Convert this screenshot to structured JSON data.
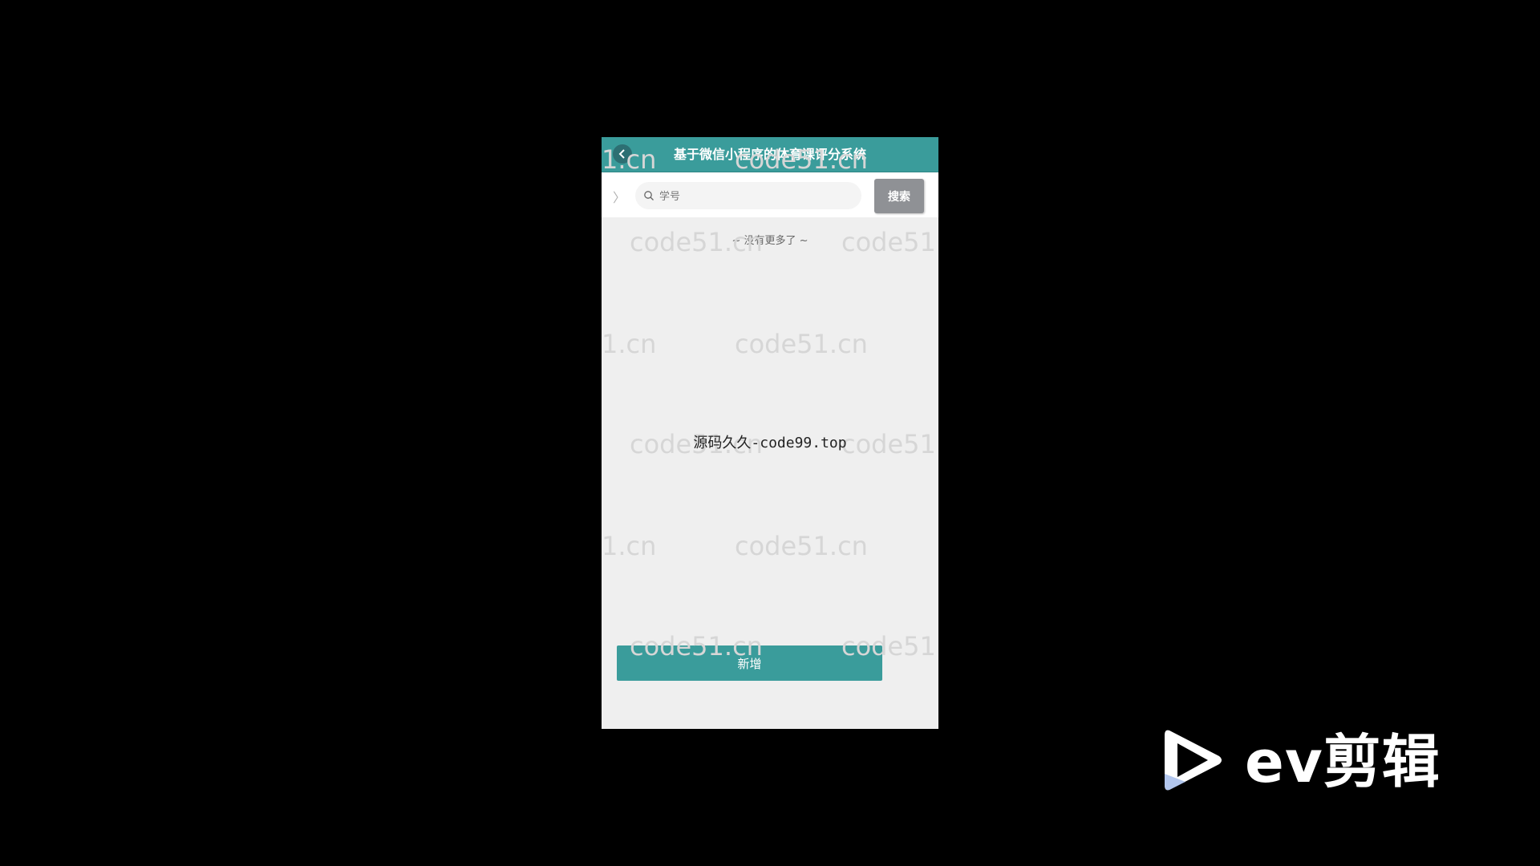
{
  "header": {
    "title": "基于微信小程序的体育课评分系统"
  },
  "search": {
    "placeholder": "学号",
    "button_label": "搜索"
  },
  "list": {
    "end_text": "~ 没有更多了 ~"
  },
  "watermarks": {
    "text_full": "code51.cn",
    "text_partial": "1.cn",
    "text_cut": "code51"
  },
  "overlay": {
    "source_text": "源码久久-code99.top"
  },
  "actions": {
    "add_label": "新增"
  },
  "branding": {
    "app_name": "ev剪辑"
  },
  "colors": {
    "primary": "#3a9c9b",
    "search_button": "#8f9195",
    "background": "#efefef"
  }
}
